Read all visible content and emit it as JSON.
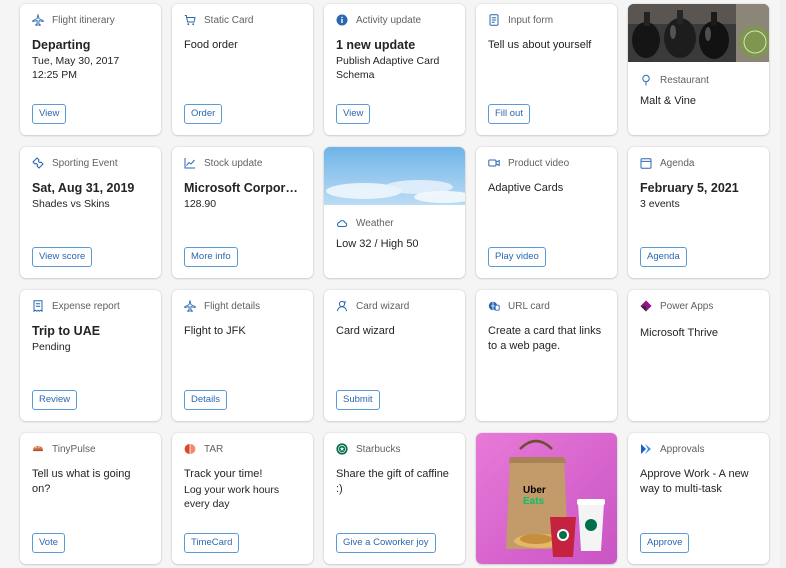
{
  "cards": {
    "flight_itinerary": {
      "header": "Flight itinerary",
      "title": "Departing",
      "line1": "Tue, May 30, 2017",
      "line2": "12:25 PM",
      "button": "View"
    },
    "static_card": {
      "header": "Static Card",
      "title": "Food order",
      "button": "Order"
    },
    "activity_update": {
      "header": "Activity update",
      "title": "1 new update",
      "line1": "Publish Adaptive Card",
      "line2": "Schema",
      "button": "View"
    },
    "input_form": {
      "header": "Input form",
      "title": "Tell us about yourself",
      "button": "Fill out"
    },
    "restaurant": {
      "header": "Restaurant",
      "title": "Malt & Vine"
    },
    "sporting_event": {
      "header": "Sporting Event",
      "title": "Sat, Aug 31, 2019",
      "line1": "Shades vs Skins",
      "button": "View score"
    },
    "stock_update": {
      "header": "Stock update",
      "title": "Microsoft Corporation",
      "line1": "128.90",
      "button": "More info"
    },
    "weather": {
      "header": "Weather",
      "title": "Low 32 / High 50"
    },
    "product_video": {
      "header": "Product video",
      "title": "Adaptive Cards",
      "button": "Play video"
    },
    "agenda": {
      "header": "Agenda",
      "title": "February 5, 2021",
      "line1": "3 events",
      "button": "Agenda"
    },
    "expense_report": {
      "header": "Expense report",
      "title": "Trip to UAE",
      "line1": "Pending",
      "button": "Review"
    },
    "flight_details": {
      "header": "Flight details",
      "title": "Flight to JFK",
      "button": "Details"
    },
    "card_wizard": {
      "header": "Card wizard",
      "title": "Card wizard",
      "button": "Submit"
    },
    "url_card": {
      "header": "URL card",
      "title": "Create a card that links to a web page."
    },
    "power_apps": {
      "header": "Power Apps",
      "title": "Microsoft Thrive"
    },
    "tinypulse": {
      "header": "TinyPulse",
      "title": "Tell us what is going on?",
      "button": "Vote"
    },
    "tar": {
      "header": "TAR",
      "title": "Track your time!",
      "line1": "Log your work hours every day",
      "button": "TimeCard"
    },
    "starbucks": {
      "header": "Starbucks",
      "title": "Share the gift of caffine :)",
      "button": "Give a Coworker joy"
    },
    "uber_eats": {
      "logo_text_1": "Uber",
      "logo_text_2": "Eats"
    },
    "approvals": {
      "header": "Approvals",
      "title": "Approve Work - A new way to multi-task",
      "button": "Approve"
    }
  },
  "colors": {
    "accent": "#2b67b1",
    "button_border": "#5b9bd5",
    "header_text": "#616161"
  }
}
